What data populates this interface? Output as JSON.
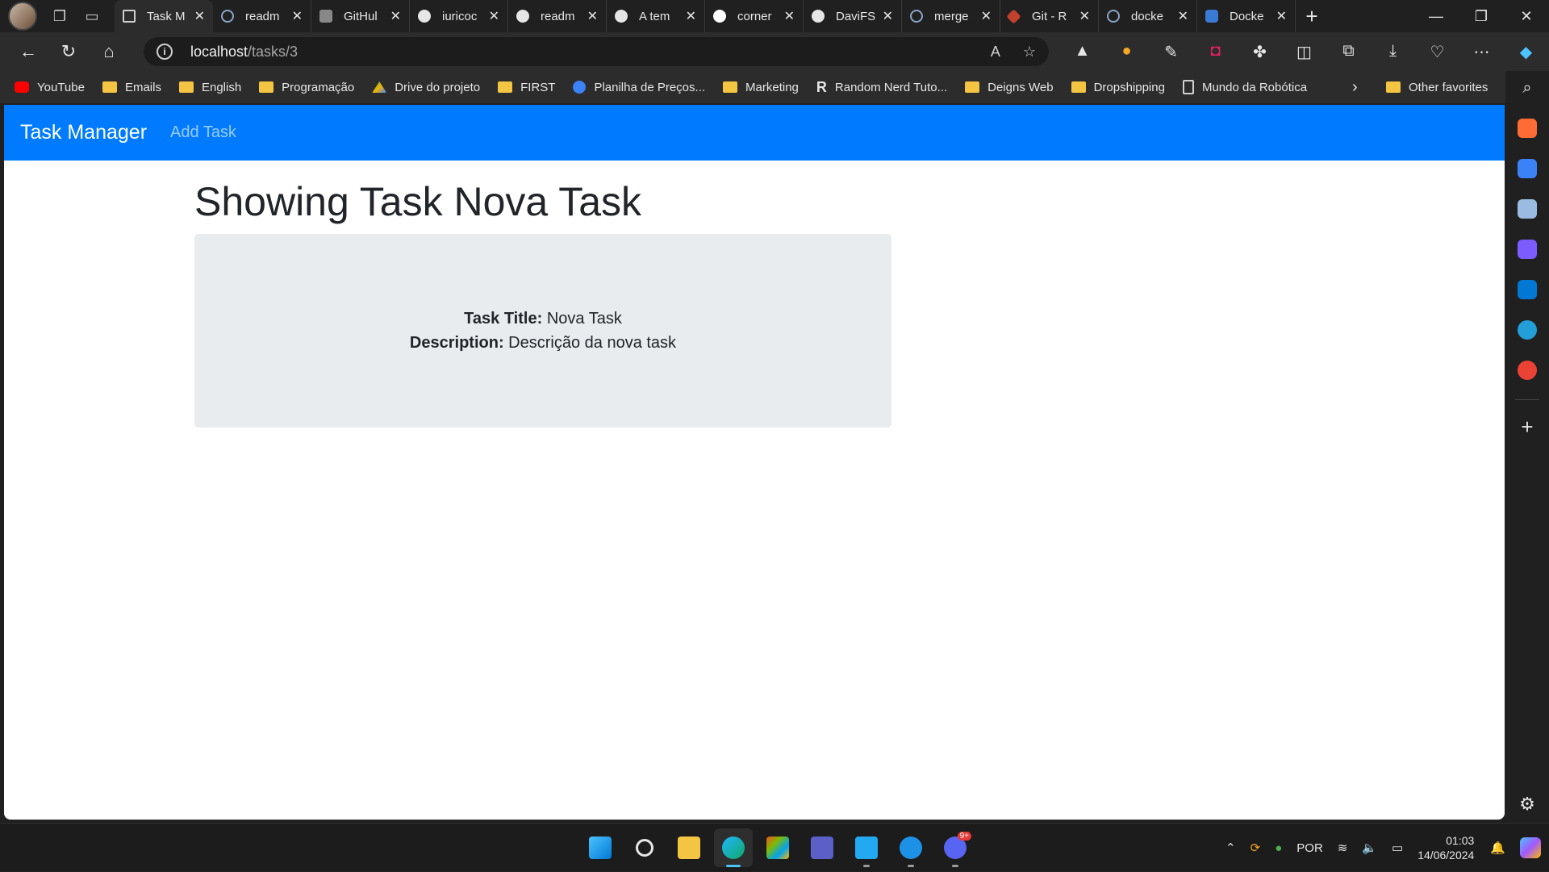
{
  "browser": {
    "tabs": [
      {
        "label": "Task M",
        "icon": "document-icon",
        "active": true
      },
      {
        "label": "readm",
        "icon": "search-icon"
      },
      {
        "label": "GitHul",
        "icon": "github-icon"
      },
      {
        "label": "iuricoc",
        "icon": "github-icon"
      },
      {
        "label": "readm",
        "icon": "github-icon"
      },
      {
        "label": "A tem",
        "icon": "github-icon"
      },
      {
        "label": "corner",
        "icon": "github-icon"
      },
      {
        "label": "DaviFS",
        "icon": "github-icon"
      },
      {
        "label": "merge",
        "icon": "search-icon"
      },
      {
        "label": "Git - R",
        "icon": "git-icon"
      },
      {
        "label": "docke",
        "icon": "search-icon"
      },
      {
        "label": "Docke",
        "icon": "docker-icon"
      }
    ],
    "address": {
      "host": "localhost",
      "path": "/tasks/3"
    },
    "favorites": [
      {
        "label": "YouTube",
        "icon": "youtube-icon"
      },
      {
        "label": "Emails",
        "icon": "folder-icon"
      },
      {
        "label": "English",
        "icon": "folder-icon"
      },
      {
        "label": "Programação",
        "icon": "folder-icon"
      },
      {
        "label": "Drive do projeto",
        "icon": "drive-icon"
      },
      {
        "label": "FIRST",
        "icon": "folder-icon"
      },
      {
        "label": "Planilha de Preços...",
        "icon": "c-icon"
      },
      {
        "label": "Marketing",
        "icon": "folder-icon"
      },
      {
        "label": "Random Nerd Tuto...",
        "icon": "r-icon"
      },
      {
        "label": "Deigns Web",
        "icon": "folder-icon"
      },
      {
        "label": "Dropshipping",
        "icon": "folder-icon"
      },
      {
        "label": "Mundo da Robótica",
        "icon": "page-icon"
      }
    ],
    "other_favorites": "Other favorites",
    "sidebar_colors": [
      "#ff6b35",
      "#3b82f6",
      "#9bbce0",
      "#7c5cff",
      "#0078d4",
      "#229ed9",
      "#ea4335"
    ]
  },
  "app": {
    "brand": "Task Manager",
    "nav_add": "Add Task",
    "heading": "Showing Task Nova Task",
    "title_label": "Task Title:",
    "title_value": "Nova Task",
    "description_label": "Description:",
    "description_value": "Descrição da nova task",
    "navbar_color": "#007bff"
  },
  "taskbar": {
    "apps": [
      "start",
      "search",
      "file-explorer",
      "edge",
      "store",
      "teams",
      "vscode",
      "docker",
      "discord"
    ],
    "discord_badge": "9+",
    "language": "POR",
    "time": "01:03",
    "date": "14/06/2024"
  }
}
